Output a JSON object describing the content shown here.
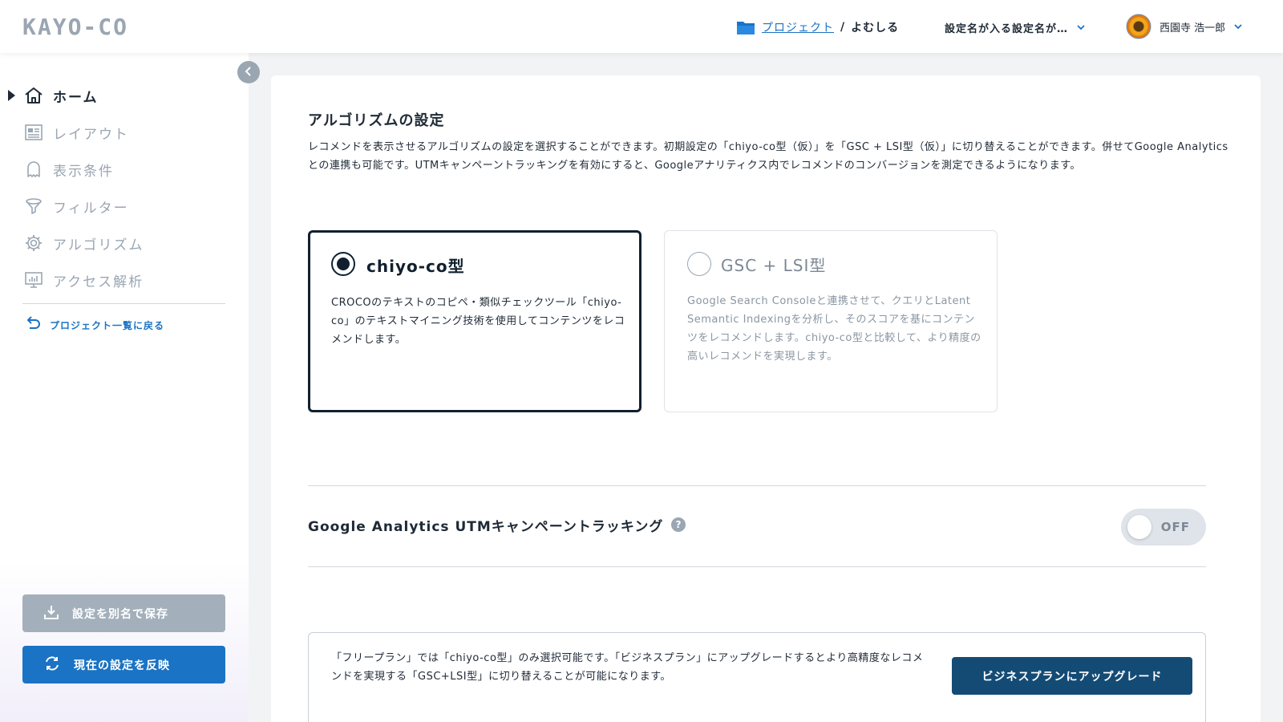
{
  "header": {
    "logo_text": "KAYO-CO",
    "breadcrumb": {
      "parent_label": "プロジェクト",
      "separator": "/",
      "current_label": "よむしる"
    },
    "setting_selector_label": "設定名が入る設定名が…",
    "user_name": "西園寺 浩一郎"
  },
  "sidebar": {
    "nav_items": [
      {
        "label": "ホーム",
        "icon": "home-icon",
        "active": true
      },
      {
        "label": "レイアウト",
        "icon": "layout-icon",
        "active": false
      },
      {
        "label": "表示条件",
        "icon": "ghost-icon",
        "active": false
      },
      {
        "label": "フィルター",
        "icon": "filter-icon",
        "active": false
      },
      {
        "label": "アルゴリズム",
        "icon": "gear-icon",
        "active": false
      },
      {
        "label": "アクセス解析",
        "icon": "monitor-chart-icon",
        "active": false
      }
    ],
    "back_link_label": "プロジェクト一覧に戻る",
    "save_as_label": "設定を別名で保存",
    "apply_label": "現在の設定を反映"
  },
  "main": {
    "title": "アルゴリズムの設定",
    "description": "レコメンドを表示させるアルゴリズムの設定を選択することができます。初期設定の「chiyo-co型（仮）」を「GSC + LSI型（仮）」に切り替えることができます。併せてGoogle Analyticsとの連携も可能です。UTMキャンペーントラッキングを有効にすると、Googleアナリティクス内でレコメンドのコンバージョンを測定できるようになります。",
    "options": [
      {
        "title": "chiyo-co型",
        "selected": true,
        "description": "CROCOのテキストのコピペ・類似チェックツール「chiyo-co」のテキストマイニング技術を使用してコンテンツをレコメンドします。"
      },
      {
        "title": "GSC + LSI型",
        "selected": false,
        "description": "Google Search Consoleと連携させて、クエリとLatent Semantic Indexingを分析し、そのスコアを基にコンテンツをレコメンドします。chiyo-co型と比較して、より精度の高いレコメンドを実現します。"
      }
    ],
    "ga_tracking_label": "Google Analytics UTMキャンペーントラッキング",
    "help_glyph": "?",
    "toggle_state_label": "OFF",
    "notice": {
      "text": "「フリープラン」では「chiyo-co型」のみ選択可能です。「ビジネスプラン」にアップグレードするとより高精度なレコメンドを実現する「GSC+LSI型」に切り替えることが可能になります。",
      "button_label": "ビジネスプランにアップグレード"
    }
  },
  "colors": {
    "accent_blue": "#1a73c4",
    "dark_navy": "#144b75",
    "selected_border": "#11202e",
    "muted_gray": "#9aa6b2"
  }
}
